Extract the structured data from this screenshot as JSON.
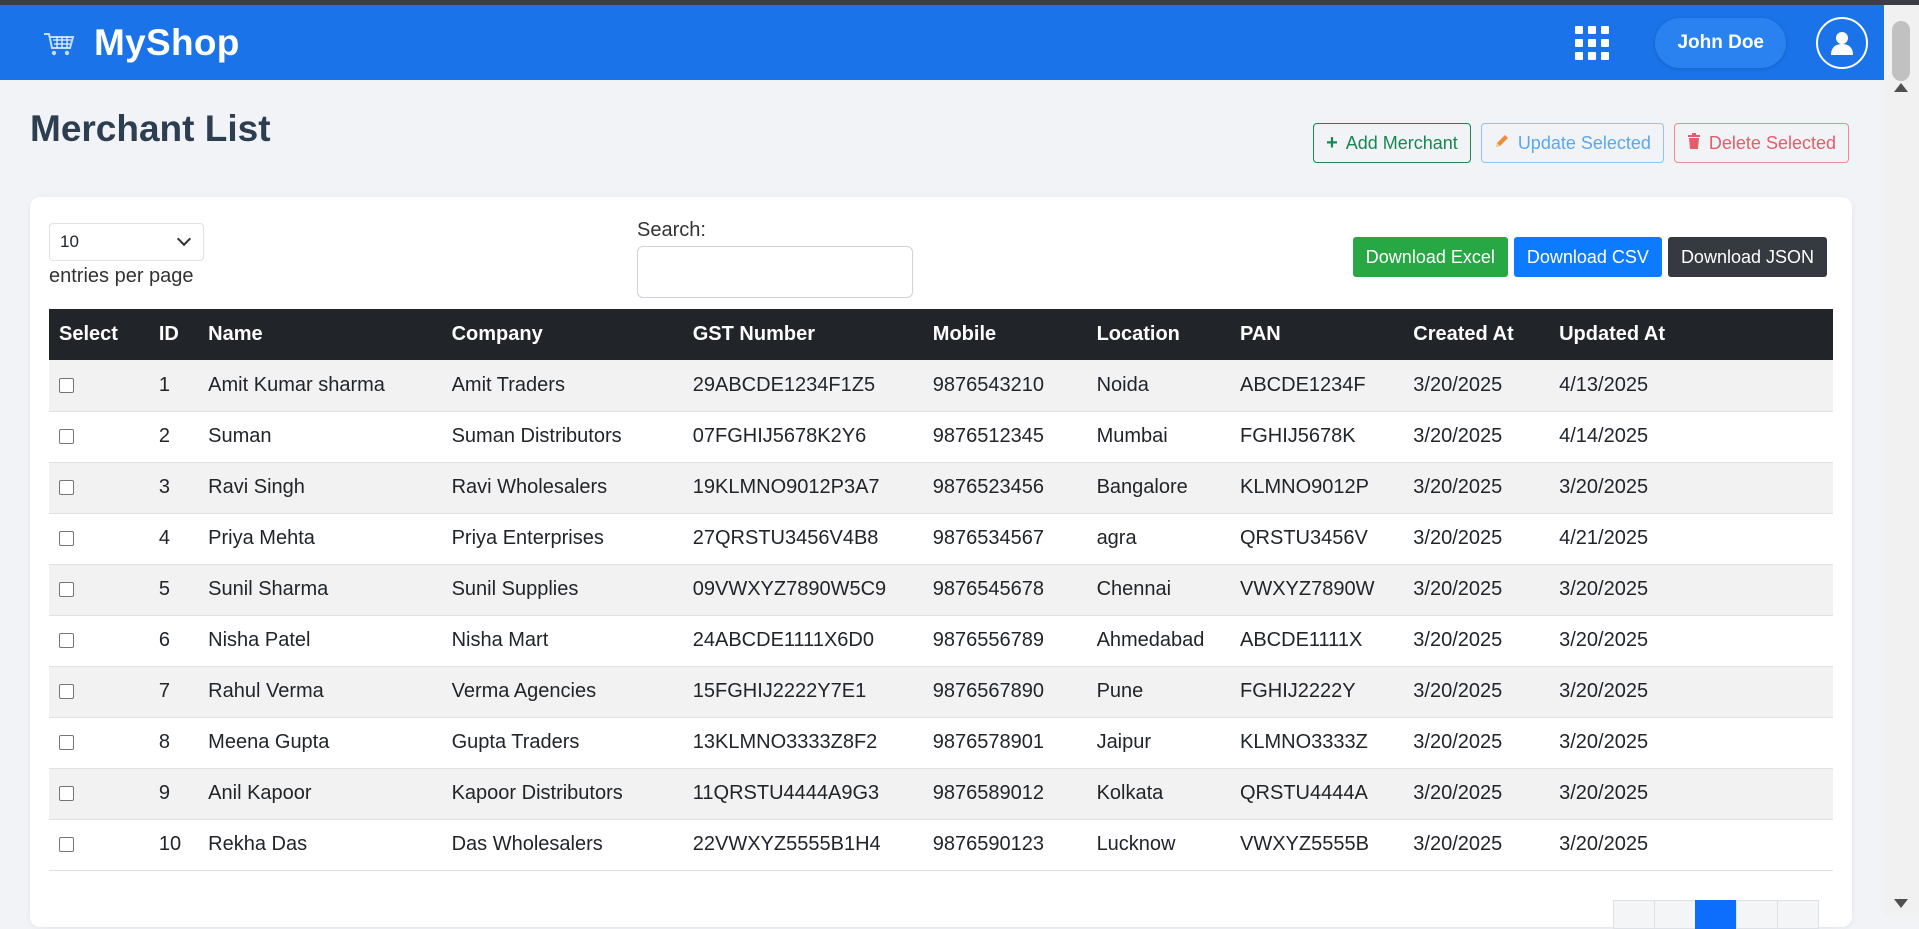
{
  "navbar": {
    "brand": "MyShop",
    "user_name": "John Doe",
    "brand_icon": "cart-icon",
    "apps_icon": "grid-icon",
    "profile_icon": "user-icon",
    "color": "#1a73e8"
  },
  "page": {
    "title": "Merchant List",
    "actions": {
      "add": "Add Merchant",
      "update": "Update Selected",
      "delete": "Delete Selected"
    }
  },
  "controls": {
    "entries_value": "10",
    "entries_label": "entries per page",
    "search_label": "Search:",
    "search_value": "",
    "download_excel": "Download Excel",
    "download_csv": "Download CSV",
    "download_json": "Download JSON"
  },
  "table": {
    "headers": [
      "Select",
      "ID",
      "Name",
      "Company",
      "GST Number",
      "Mobile",
      "Location",
      "PAN",
      "Created At",
      "Updated At"
    ],
    "rows": [
      [
        "1",
        "Amit Kumar sharma",
        "Amit Traders",
        "29ABCDE1234F1Z5",
        "9876543210",
        "Noida",
        "ABCDE1234F",
        "3/20/2025",
        "4/13/2025"
      ],
      [
        "2",
        "Suman",
        "Suman Distributors",
        "07FGHIJ5678K2Y6",
        "9876512345",
        "Mumbai",
        "FGHIJ5678K",
        "3/20/2025",
        "4/14/2025"
      ],
      [
        "3",
        "Ravi Singh",
        "Ravi Wholesalers",
        "19KLMNO9012P3A7",
        "9876523456",
        "Bangalore",
        "KLMNO9012P",
        "3/20/2025",
        "3/20/2025"
      ],
      [
        "4",
        "Priya Mehta",
        "Priya Enterprises",
        "27QRSTU3456V4B8",
        "9876534567",
        "agra",
        "QRSTU3456V",
        "3/20/2025",
        "4/21/2025"
      ],
      [
        "5",
        "Sunil Sharma",
        "Sunil Supplies",
        "09VWXYZ7890W5C9",
        "9876545678",
        "Chennai",
        "VWXYZ7890W",
        "3/20/2025",
        "3/20/2025"
      ],
      [
        "6",
        "Nisha Patel",
        "Nisha Mart",
        "24ABCDE1111X6D0",
        "9876556789",
        "Ahmedabad",
        "ABCDE1111X",
        "3/20/2025",
        "3/20/2025"
      ],
      [
        "7",
        "Rahul Verma",
        "Verma Agencies",
        "15FGHIJ2222Y7E1",
        "9876567890",
        "Pune",
        "FGHIJ2222Y",
        "3/20/2025",
        "3/20/2025"
      ],
      [
        "8",
        "Meena Gupta",
        "Gupta Traders",
        "13KLMNO3333Z8F2",
        "9876578901",
        "Jaipur",
        "KLMNO3333Z",
        "3/20/2025",
        "3/20/2025"
      ],
      [
        "9",
        "Anil Kapoor",
        "Kapoor Distributors",
        "11QRSTU4444A9G3",
        "9876589012",
        "Kolkata",
        "QRSTU4444A",
        "3/20/2025",
        "3/20/2025"
      ],
      [
        "10",
        "Rekha Das",
        "Das Wholesalers",
        "22VWXYZ5555B1H4",
        "9876590123",
        "Lucknow",
        "VWXYZ5555B",
        "3/20/2025",
        "3/20/2025"
      ]
    ]
  }
}
